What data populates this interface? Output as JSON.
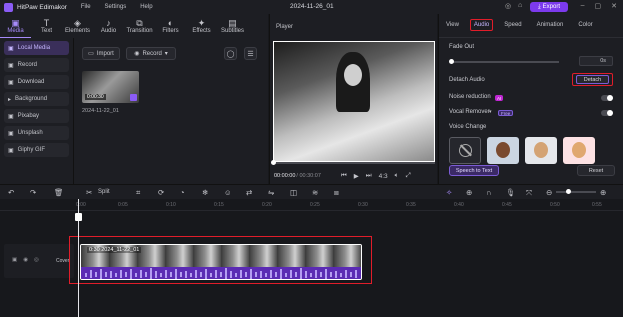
{
  "app": {
    "name": "HitPaw Edimakor",
    "menus": [
      "File",
      "Settings",
      "Help"
    ],
    "project_title": "2024-11-26_01",
    "export_label": "Export"
  },
  "top_tools": [
    {
      "label": "Media",
      "icon": "media-icon",
      "glyph": "▣"
    },
    {
      "label": "Text",
      "icon": "text-icon",
      "glyph": "T"
    },
    {
      "label": "Elements",
      "icon": "elements-icon",
      "glyph": "◈"
    },
    {
      "label": "Audio",
      "icon": "audio-icon",
      "glyph": "♪"
    },
    {
      "label": "Transition",
      "icon": "transition-icon",
      "glyph": "⧉"
    },
    {
      "label": "Filters",
      "icon": "filters-icon",
      "glyph": "◐"
    },
    {
      "label": "Effects",
      "icon": "effects-icon",
      "glyph": "✦"
    },
    {
      "label": "Subtitles",
      "icon": "subtitles-icon",
      "glyph": "▤"
    }
  ],
  "left_nav": [
    {
      "label": "Local Media",
      "glyph": "▣"
    },
    {
      "label": "Record",
      "glyph": "▣"
    },
    {
      "label": "Download",
      "glyph": "▣"
    },
    {
      "label": "Background",
      "glyph": "▸"
    },
    {
      "label": "Pixabay",
      "glyph": "▣"
    },
    {
      "label": "Unsplash",
      "glyph": "▣"
    },
    {
      "label": "Giphy GIF",
      "glyph": "▣"
    }
  ],
  "media": {
    "import_label": "Import",
    "record_label": "Record",
    "item_name": "2024-11-22_01",
    "item_duration": "0:00:30"
  },
  "player": {
    "label": "Player",
    "time_current": "00:00:00",
    "time_total": "/ 00:30:07",
    "ratio": "4:3",
    "progress": 0
  },
  "right_panel": {
    "tabs": [
      "View",
      "Audio",
      "Speed",
      "Animation",
      "Color"
    ],
    "active_tab": "Audio",
    "fade_out_label": "Fade Out",
    "fade_out_value": "0s",
    "detach_audio_label": "Detach Audio",
    "detach_button": "Detach",
    "noise_reduction_label": "Noise reduction",
    "noise_tag": "AI",
    "vocal_remover_label": "Vocal Remover",
    "vocal_tag": "Free",
    "voice_change_label": "Voice Change",
    "speech_to_text": "Speech to Text",
    "reset": "Reset"
  },
  "timeline": {
    "split_label": "Split",
    "ruler_ticks": [
      "0:00",
      "0:05",
      "0:10",
      "0:15",
      "0:20",
      "0:25",
      "0:30",
      "0:35",
      "0:40",
      "0:45",
      "0:50",
      "0:55",
      "1:00",
      "1:05"
    ],
    "cover_label": "Cover",
    "clip_label": "0:30 2024_11-22_01"
  }
}
